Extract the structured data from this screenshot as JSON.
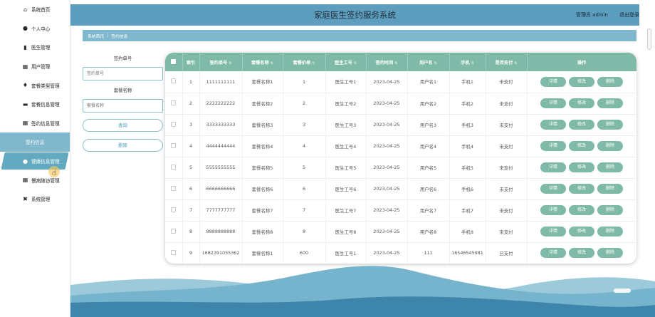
{
  "app": {
    "title": "家庭医生签约服务系统",
    "user": "管理员 admin",
    "logout": "退出登录"
  },
  "sidebar": {
    "items": [
      {
        "label": "系统首页",
        "icon": "home-icon",
        "glyph": "⌂"
      },
      {
        "label": "个人中心",
        "icon": "person-icon",
        "glyph": "●"
      },
      {
        "label": "医生管理",
        "icon": "clipboard-icon",
        "glyph": "▮"
      },
      {
        "label": "用户管理",
        "icon": "grid-icon",
        "glyph": "▦"
      },
      {
        "label": "套餐类型管理",
        "icon": "location-pin-icon",
        "glyph": "♦"
      },
      {
        "label": "套餐信息管理",
        "icon": "monitor-icon",
        "glyph": "▬"
      },
      {
        "label": "签约信息管理",
        "icon": "grid-icon",
        "glyph": "▦"
      },
      {
        "label": "签约信息",
        "icon": "",
        "glyph": ""
      },
      {
        "label": "健康信息管理",
        "icon": "person-icon",
        "glyph": "●"
      },
      {
        "label": "慢病随访管理",
        "icon": "grid-icon",
        "glyph": "▦"
      },
      {
        "label": "系统管理",
        "icon": "tools-icon",
        "glyph": "✖"
      }
    ]
  },
  "breadcrumb": {
    "home": "系统首页",
    "separator": "|",
    "current": "签约信息"
  },
  "search": {
    "fields": [
      {
        "label": "签约单号",
        "placeholder": "签约单号"
      },
      {
        "label": "套餐名称",
        "placeholder": "套餐名称"
      }
    ],
    "query_button": "查询",
    "delete_button": "删除"
  },
  "table": {
    "columns": [
      "",
      "索引",
      "签约单号",
      "套餐名称",
      "套餐价格",
      "医生工号",
      "签约时间",
      "用户名",
      "手机",
      "是否支付",
      "操作"
    ],
    "sortable": [
      false,
      false,
      true,
      true,
      true,
      true,
      true,
      true,
      true,
      true,
      false
    ],
    "action_labels": [
      "详情",
      "修改",
      "删除"
    ],
    "rows": [
      {
        "index": "1",
        "order_no": "1111111111",
        "package": "套餐名称1",
        "price": "1",
        "doctor_id": "医生工号1",
        "date": "2023-04-25",
        "username": "用户名1",
        "phone": "手机1",
        "paid": "未支付"
      },
      {
        "index": "2",
        "order_no": "2222222222",
        "package": "套餐名称2",
        "price": "2",
        "doctor_id": "医生工号2",
        "date": "2023-04-25",
        "username": "用户名2",
        "phone": "手机2",
        "paid": "未支付"
      },
      {
        "index": "3",
        "order_no": "3333333333",
        "package": "套餐名称3",
        "price": "3",
        "doctor_id": "医生工号3",
        "date": "2023-04-25",
        "username": "用户名3",
        "phone": "手机3",
        "paid": "未支付"
      },
      {
        "index": "4",
        "order_no": "4444444444",
        "package": "套餐名称4",
        "price": "4",
        "doctor_id": "医生工号4",
        "date": "2023-04-25",
        "username": "用户名4",
        "phone": "手机4",
        "paid": "未支付"
      },
      {
        "index": "5",
        "order_no": "5555555555",
        "package": "套餐名称5",
        "price": "5",
        "doctor_id": "医生工号5",
        "date": "2023-04-25",
        "username": "用户名5",
        "phone": "手机5",
        "paid": "未支付"
      },
      {
        "index": "6",
        "order_no": "6666666666",
        "package": "套餐名称6",
        "price": "6",
        "doctor_id": "医生工号6",
        "date": "2023-04-25",
        "username": "用户名6",
        "phone": "手机6",
        "paid": "未支付"
      },
      {
        "index": "7",
        "order_no": "7777777777",
        "package": "套餐名称7",
        "price": "7",
        "doctor_id": "医生工号7",
        "date": "2023-04-25",
        "username": "用户名7",
        "phone": "手机7",
        "paid": "未支付"
      },
      {
        "index": "8",
        "order_no": "8888888888",
        "package": "套餐名称8",
        "price": "8",
        "doctor_id": "医生工号8",
        "date": "2023-04-25",
        "username": "用户名8",
        "phone": "手机8",
        "paid": "未支付"
      },
      {
        "index": "9",
        "order_no": "1682391055362",
        "package": "套餐名称1",
        "price": "600",
        "doctor_id": "医生工号1",
        "date": "2023-04-25",
        "username": "111",
        "phone": "16546545981",
        "paid": "已支付"
      }
    ]
  },
  "colors": {
    "header": "#5d9dbd",
    "accent": "#7fb8cc",
    "table_header": "#7fbaa8",
    "action_button": "#7fbaa8"
  }
}
